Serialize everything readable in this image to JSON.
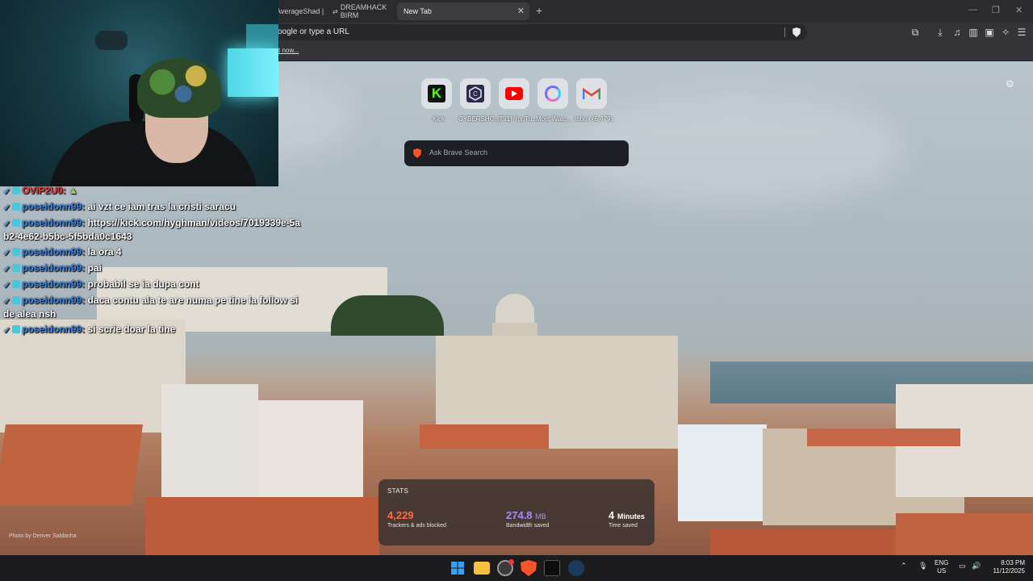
{
  "browser": {
    "tabs": [
      {
        "label": "AverageShad |",
        "active": false
      },
      {
        "label": "DREAMHACK BIRM",
        "active": false
      },
      {
        "label": "New Tab",
        "active": true
      }
    ],
    "url_placeholder": "oogle or type a URL",
    "bookmark_link": "t now..."
  },
  "chat": {
    "messages": [
      {
        "user": "OViP2U0:",
        "text": ""
      },
      {
        "user": "poseidonn99:",
        "text": "ai vzt ce iam tras la cristi saracu"
      },
      {
        "user": "poseidonn99:",
        "text": "https://kick.com/hyghman/videos/7019339e-5ab2-4e62-b5bc-5f5bda0c1643"
      },
      {
        "user": "poseidonn99:",
        "text": "la ora 4"
      },
      {
        "user": "poseidonn99:",
        "text": "pai"
      },
      {
        "user": "poseidonn99:",
        "text": "probabil se ia dupa cont"
      },
      {
        "user": "poseidonn99:",
        "text": "daca contu ala te are numa pe tine la follow si de alea nsh"
      },
      {
        "user": "poseidonn99:",
        "text": "si scrie doar la tine"
      }
    ]
  },
  "newtab": {
    "top_sites": [
      {
        "label": "Kick",
        "icon": "kick-icon"
      },
      {
        "label": "CYBERSHO...",
        "icon": "cybershoke-icon"
      },
      {
        "label": "(791) YouTu...",
        "icon": "youtube-icon"
      },
      {
        "label": "Most Watc...",
        "icon": "most-watched-icon"
      },
      {
        "label": "Inbox (6,479)",
        "icon": "gmail-icon"
      }
    ],
    "search_placeholder": "Ask Brave Search",
    "stats": {
      "title": "STATS",
      "trackers_value": "4,229",
      "trackers_caption": "Trackers & ads blocked",
      "bandwidth_value": "274.8",
      "bandwidth_unit": "MB",
      "bandwidth_caption": "Bandwidth saved",
      "time_value": "4",
      "time_unit": "Minutes",
      "time_caption": "Time saved"
    },
    "photo_credit": "Photo by Denver Saldanha",
    "colors": {
      "trackers": "#ff6b45",
      "bandwidth": "#a78bfa",
      "time": "#ffffff"
    }
  },
  "taskbar": {
    "lang_line1": "ENG",
    "lang_line2": "US",
    "time": "8:03 PM",
    "date": "11/12/2025"
  }
}
